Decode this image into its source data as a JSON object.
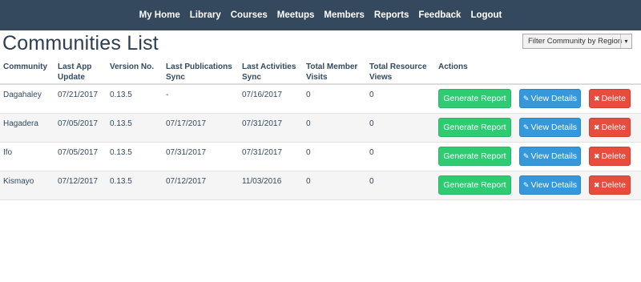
{
  "nav": {
    "items": [
      {
        "label": "My Home",
        "name": "nav-my-home"
      },
      {
        "label": "Library",
        "name": "nav-library"
      },
      {
        "label": "Courses",
        "name": "nav-courses"
      },
      {
        "label": "Meetups",
        "name": "nav-meetups"
      },
      {
        "label": "Members",
        "name": "nav-members"
      },
      {
        "label": "Reports",
        "name": "nav-reports"
      },
      {
        "label": "Feedback",
        "name": "nav-feedback"
      },
      {
        "label": "Logout",
        "name": "nav-logout"
      }
    ],
    "background": "#34495e"
  },
  "page": {
    "title": "Communities List"
  },
  "filter": {
    "label": "Filter Community by Region",
    "caret": "▾"
  },
  "table": {
    "headers": {
      "community": "Community",
      "last_app_update": "Last App Update",
      "version": "Version No.",
      "last_publications_sync": "Last Publications Sync",
      "last_activities_sync": "Last Activities Sync",
      "total_member_visits": "Total Member Visits",
      "total_resource_views": "Total Resource Views",
      "actions": "Actions"
    },
    "rows": [
      {
        "community": "Dagahaley",
        "last_app_update": "07/21/2017",
        "version": "0.13.5",
        "last_publications_sync": "-",
        "last_activities_sync": "07/16/2017",
        "total_member_visits": "0",
        "total_resource_views": "0"
      },
      {
        "community": "Hagadera",
        "last_app_update": "07/05/2017",
        "version": "0.13.5",
        "last_publications_sync": "07/17/2017",
        "last_activities_sync": "07/31/2017",
        "total_member_visits": "0",
        "total_resource_views": "0"
      },
      {
        "community": "Ifo",
        "last_app_update": "07/05/2017",
        "version": "0.13.5",
        "last_publications_sync": "07/31/2017",
        "last_activities_sync": "07/31/2017",
        "total_member_visits": "0",
        "total_resource_views": "0"
      },
      {
        "community": "Kismayo",
        "last_app_update": "07/12/2017",
        "version": "0.13.5",
        "last_publications_sync": "07/12/2017",
        "last_activities_sync": "11/03/2016",
        "total_member_visits": "0",
        "total_resource_views": "0"
      }
    ]
  },
  "actions": {
    "generate_report": "Generate Report",
    "view_details": "View Details",
    "delete": "Delete",
    "view_icon": "pencil-icon",
    "delete_icon": "close-icon"
  },
  "colors": {
    "report": "#2ecc71",
    "view": "#3498db",
    "delete": "#e74c3c"
  }
}
